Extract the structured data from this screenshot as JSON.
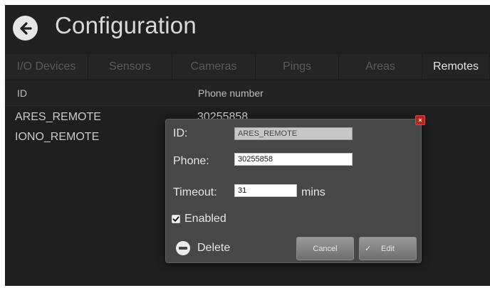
{
  "header": {
    "title": "Configuration",
    "back_icon": "arrow-left-circle-icon"
  },
  "tabs": [
    {
      "label": "I/O Devices",
      "active": false
    },
    {
      "label": "Sensors",
      "active": false
    },
    {
      "label": "Cameras",
      "active": false
    },
    {
      "label": "Pings",
      "active": false
    },
    {
      "label": "Areas",
      "active": false
    },
    {
      "label": "Remotes",
      "active": true
    }
  ],
  "table": {
    "columns": [
      "ID",
      "Phone number"
    ],
    "rows": [
      {
        "id": "ARES_REMOTE",
        "phone": "30255858"
      },
      {
        "id": "IONO_REMOTE",
        "phone": ""
      }
    ]
  },
  "dialog": {
    "id_label": "ID:",
    "id_value": "ARES_REMOTE",
    "phone_label": "Phone:",
    "phone_value": "30255858",
    "timeout_label": "Timeout:",
    "timeout_value": "31",
    "timeout_unit": "mins",
    "enabled_label": "Enabled",
    "enabled_checked": true,
    "delete_label": "Delete",
    "cancel_label": "Cancel",
    "edit_label": "Edit",
    "close_glyph": "×"
  },
  "colors": {
    "background": "#1e1e1e",
    "dialog": "#474747",
    "close_button": "#b3261e"
  }
}
